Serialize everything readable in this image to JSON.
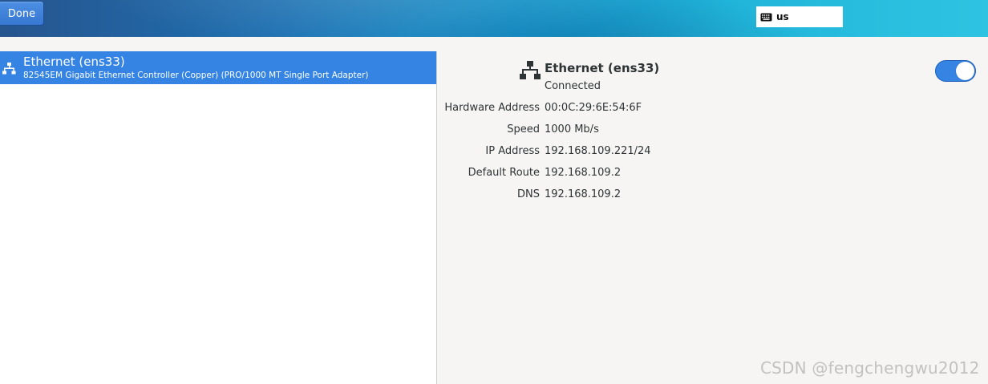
{
  "header": {
    "done_label": "Done",
    "keyboard_layout": "us"
  },
  "devices": [
    {
      "name": "Ethernet (ens33)",
      "description": "82545EM Gigabit Ethernet Controller (Copper) (PRO/1000 MT Single Port Adapter)",
      "icon": "wired-network-icon",
      "selected": true
    }
  ],
  "details": {
    "title": "Ethernet (ens33)",
    "status": "Connected",
    "enabled": true,
    "properties": [
      {
        "label": "Hardware Address",
        "value": "00:0C:29:6E:54:6F"
      },
      {
        "label": "Speed",
        "value": "1000 Mb/s"
      },
      {
        "label": "IP Address",
        "value": "192.168.109.221/24"
      },
      {
        "label": "Default Route",
        "value": "192.168.109.2"
      },
      {
        "label": "DNS",
        "value": "192.168.109.2"
      }
    ]
  },
  "watermark": "CSDN @fengchengwu2012",
  "colors": {
    "accent": "#3584e4",
    "pane_bg": "#f6f5f4"
  }
}
